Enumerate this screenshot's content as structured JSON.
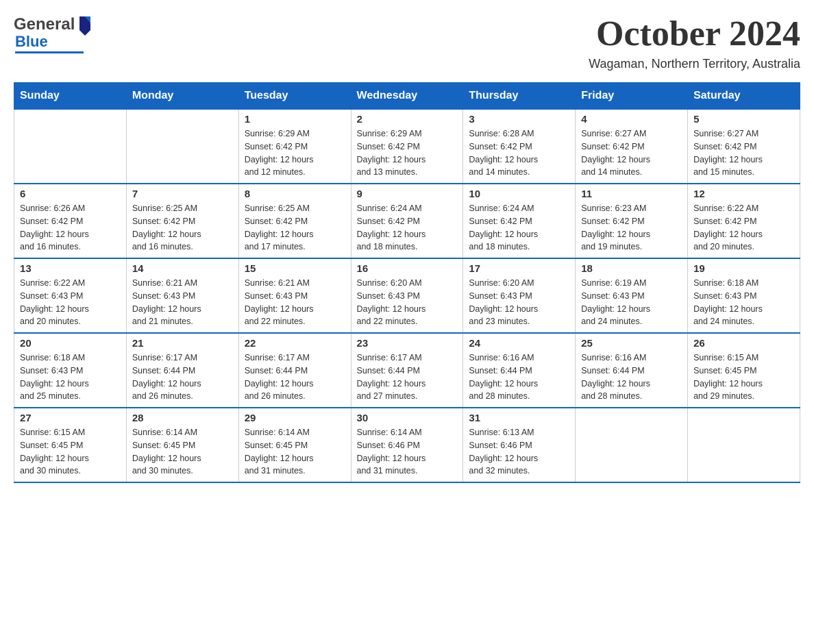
{
  "header": {
    "logo_general": "General",
    "logo_blue": "Blue",
    "month_title": "October 2024",
    "location": "Wagaman, Northern Territory, Australia"
  },
  "calendar": {
    "headers": [
      "Sunday",
      "Monday",
      "Tuesday",
      "Wednesday",
      "Thursday",
      "Friday",
      "Saturday"
    ],
    "weeks": [
      [
        {
          "day": "",
          "info": ""
        },
        {
          "day": "",
          "info": ""
        },
        {
          "day": "1",
          "info": "Sunrise: 6:29 AM\nSunset: 6:42 PM\nDaylight: 12 hours\nand 12 minutes."
        },
        {
          "day": "2",
          "info": "Sunrise: 6:29 AM\nSunset: 6:42 PM\nDaylight: 12 hours\nand 13 minutes."
        },
        {
          "day": "3",
          "info": "Sunrise: 6:28 AM\nSunset: 6:42 PM\nDaylight: 12 hours\nand 14 minutes."
        },
        {
          "day": "4",
          "info": "Sunrise: 6:27 AM\nSunset: 6:42 PM\nDaylight: 12 hours\nand 14 minutes."
        },
        {
          "day": "5",
          "info": "Sunrise: 6:27 AM\nSunset: 6:42 PM\nDaylight: 12 hours\nand 15 minutes."
        }
      ],
      [
        {
          "day": "6",
          "info": "Sunrise: 6:26 AM\nSunset: 6:42 PM\nDaylight: 12 hours\nand 16 minutes."
        },
        {
          "day": "7",
          "info": "Sunrise: 6:25 AM\nSunset: 6:42 PM\nDaylight: 12 hours\nand 16 minutes."
        },
        {
          "day": "8",
          "info": "Sunrise: 6:25 AM\nSunset: 6:42 PM\nDaylight: 12 hours\nand 17 minutes."
        },
        {
          "day": "9",
          "info": "Sunrise: 6:24 AM\nSunset: 6:42 PM\nDaylight: 12 hours\nand 18 minutes."
        },
        {
          "day": "10",
          "info": "Sunrise: 6:24 AM\nSunset: 6:42 PM\nDaylight: 12 hours\nand 18 minutes."
        },
        {
          "day": "11",
          "info": "Sunrise: 6:23 AM\nSunset: 6:42 PM\nDaylight: 12 hours\nand 19 minutes."
        },
        {
          "day": "12",
          "info": "Sunrise: 6:22 AM\nSunset: 6:42 PM\nDaylight: 12 hours\nand 20 minutes."
        }
      ],
      [
        {
          "day": "13",
          "info": "Sunrise: 6:22 AM\nSunset: 6:43 PM\nDaylight: 12 hours\nand 20 minutes."
        },
        {
          "day": "14",
          "info": "Sunrise: 6:21 AM\nSunset: 6:43 PM\nDaylight: 12 hours\nand 21 minutes."
        },
        {
          "day": "15",
          "info": "Sunrise: 6:21 AM\nSunset: 6:43 PM\nDaylight: 12 hours\nand 22 minutes."
        },
        {
          "day": "16",
          "info": "Sunrise: 6:20 AM\nSunset: 6:43 PM\nDaylight: 12 hours\nand 22 minutes."
        },
        {
          "day": "17",
          "info": "Sunrise: 6:20 AM\nSunset: 6:43 PM\nDaylight: 12 hours\nand 23 minutes."
        },
        {
          "day": "18",
          "info": "Sunrise: 6:19 AM\nSunset: 6:43 PM\nDaylight: 12 hours\nand 24 minutes."
        },
        {
          "day": "19",
          "info": "Sunrise: 6:18 AM\nSunset: 6:43 PM\nDaylight: 12 hours\nand 24 minutes."
        }
      ],
      [
        {
          "day": "20",
          "info": "Sunrise: 6:18 AM\nSunset: 6:43 PM\nDaylight: 12 hours\nand 25 minutes."
        },
        {
          "day": "21",
          "info": "Sunrise: 6:17 AM\nSunset: 6:44 PM\nDaylight: 12 hours\nand 26 minutes."
        },
        {
          "day": "22",
          "info": "Sunrise: 6:17 AM\nSunset: 6:44 PM\nDaylight: 12 hours\nand 26 minutes."
        },
        {
          "day": "23",
          "info": "Sunrise: 6:17 AM\nSunset: 6:44 PM\nDaylight: 12 hours\nand 27 minutes."
        },
        {
          "day": "24",
          "info": "Sunrise: 6:16 AM\nSunset: 6:44 PM\nDaylight: 12 hours\nand 28 minutes."
        },
        {
          "day": "25",
          "info": "Sunrise: 6:16 AM\nSunset: 6:44 PM\nDaylight: 12 hours\nand 28 minutes."
        },
        {
          "day": "26",
          "info": "Sunrise: 6:15 AM\nSunset: 6:45 PM\nDaylight: 12 hours\nand 29 minutes."
        }
      ],
      [
        {
          "day": "27",
          "info": "Sunrise: 6:15 AM\nSunset: 6:45 PM\nDaylight: 12 hours\nand 30 minutes."
        },
        {
          "day": "28",
          "info": "Sunrise: 6:14 AM\nSunset: 6:45 PM\nDaylight: 12 hours\nand 30 minutes."
        },
        {
          "day": "29",
          "info": "Sunrise: 6:14 AM\nSunset: 6:45 PM\nDaylight: 12 hours\nand 31 minutes."
        },
        {
          "day": "30",
          "info": "Sunrise: 6:14 AM\nSunset: 6:46 PM\nDaylight: 12 hours\nand 31 minutes."
        },
        {
          "day": "31",
          "info": "Sunrise: 6:13 AM\nSunset: 6:46 PM\nDaylight: 12 hours\nand 32 minutes."
        },
        {
          "day": "",
          "info": ""
        },
        {
          "day": "",
          "info": ""
        }
      ]
    ]
  }
}
